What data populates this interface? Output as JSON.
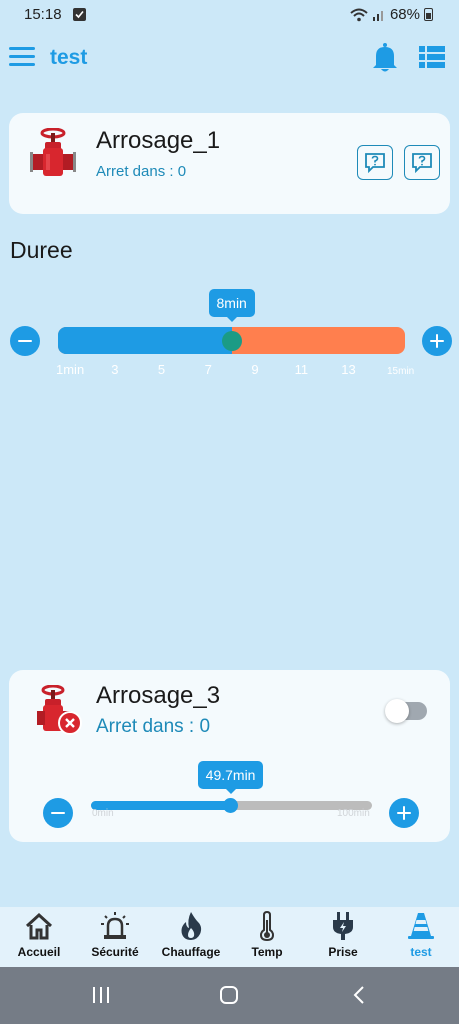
{
  "status_bar": {
    "time": "15:18",
    "battery": "68%"
  },
  "app_bar": {
    "title": "test",
    "menu_icon": "hamburger-menu-icon",
    "notification_icon": "bell-icon",
    "view_icon": "list-view-icon"
  },
  "card1": {
    "title": "Arrosage_1",
    "subtitle": "Arret dans : 0",
    "icon": "red-valve-icon",
    "help_icon": "help-chat-icon"
  },
  "duree": {
    "title": "Duree",
    "value": 8,
    "min": 1,
    "max": 15,
    "tooltip": "8min",
    "ticks": [
      "1min",
      "3",
      "5",
      "7",
      "9",
      "11",
      "13",
      "15min"
    ],
    "colors": {
      "selected": "#1e9be4",
      "unselected": "#ff7f4e",
      "thumb": "#1b9b85"
    }
  },
  "card3": {
    "title": "Arrosage_3",
    "subtitle": "Arret dans : 0",
    "icon": "red-valve-error-icon",
    "toggle_on": false,
    "slider": {
      "value": 49.7,
      "min": 0,
      "max": 100,
      "tooltip": "49.7min",
      "min_label": "0min",
      "max_label": "100min"
    }
  },
  "bottom_nav": {
    "items": [
      {
        "label": "Accueil",
        "icon": "home-icon"
      },
      {
        "label": "Sécurité",
        "icon": "alarm-siren-icon"
      },
      {
        "label": "Chauffage",
        "icon": "flame-icon"
      },
      {
        "label": "Temp",
        "icon": "thermometer-icon"
      },
      {
        "label": "Prise",
        "icon": "plug-icon"
      },
      {
        "label": "test",
        "icon": "cone-icon",
        "active": true
      }
    ]
  },
  "colors": {
    "accent": "#1e9be4",
    "background": "#cce8f8",
    "card": "#f4fafd"
  }
}
